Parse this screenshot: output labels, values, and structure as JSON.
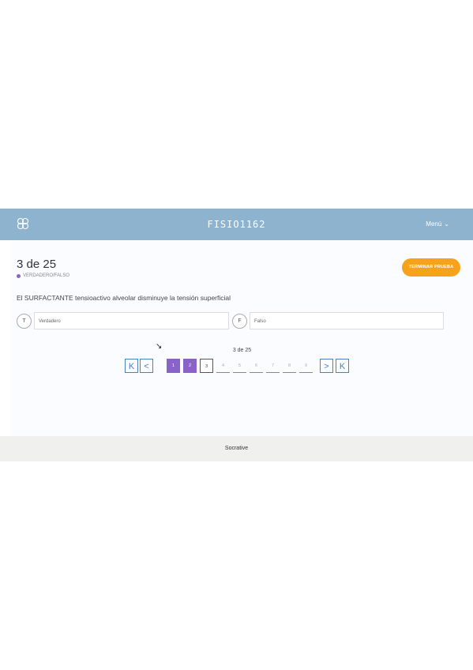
{
  "header": {
    "title": "FISIO1162",
    "menu_label": "Menú",
    "menu_chevron": "⌄"
  },
  "quiz": {
    "count_label": "3 de 25",
    "type_label": "VERDADERO/FALSO",
    "finish_button": "TERMINAR PRUEBA",
    "question_text": "El SURFACTANTE tensioactivo alveolar disminuye la tensión superficial",
    "options": [
      {
        "letter": "T",
        "label": "Verdadero"
      },
      {
        "letter": "F",
        "label": "Falso"
      }
    ]
  },
  "pagination": {
    "info": "3 de 25",
    "first_glyph": "K",
    "prev_glyph": "<",
    "next_glyph": ">",
    "last_glyph": "K",
    "pages": [
      "1",
      "2",
      "3",
      "4",
      "5",
      "6",
      "7",
      "8",
      "9"
    ],
    "answered_count": 2,
    "current_page": 3
  },
  "footer": {
    "text": "Socrative"
  },
  "colors": {
    "header": "#8db3cf",
    "accent": "#8a63c9",
    "finish": "#f7a21b",
    "nav": "#4a7fc1"
  }
}
